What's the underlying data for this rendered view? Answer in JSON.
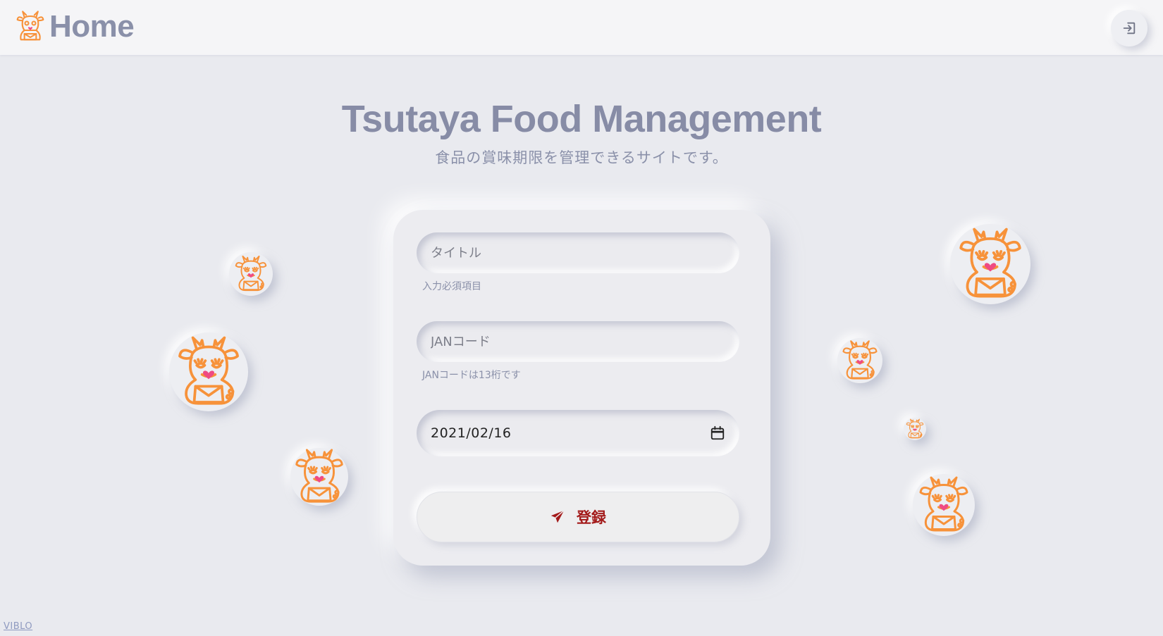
{
  "header": {
    "title": "Home",
    "logo_icon": "mascot-logo",
    "logout_icon": "logout-icon"
  },
  "hero": {
    "title": "Tsutaya Food Management",
    "subtitle": "食品の賞味期限を管理できるサイトです。"
  },
  "form": {
    "title_field": {
      "placeholder": "タイトル",
      "value": "",
      "hint": "入力必須項目"
    },
    "jan_field": {
      "placeholder": "JANコード",
      "value": "",
      "hint": "JANコードは13桁です"
    },
    "date_field": {
      "value": "2021/02/16",
      "icon": "calendar-icon"
    },
    "submit": {
      "label": "登録",
      "icon": "send-icon"
    }
  },
  "footer": {
    "mark": "VIBLO"
  },
  "colors": {
    "background": "#e9eaef",
    "heading": "#878ca6",
    "accent_orange": "#f7923a",
    "heart_pink": "#ef4a83",
    "submit_text": "#a31a1a"
  }
}
